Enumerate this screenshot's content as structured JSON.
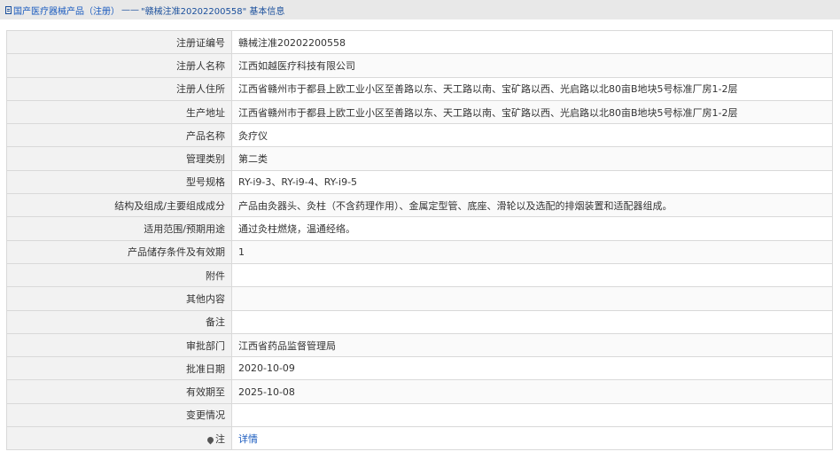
{
  "breadcrumb": {
    "root": "国产医疗器械产品（注册）",
    "separator": "——",
    "current": "\"赣械注准20202200558\" 基本信息"
  },
  "rows": [
    {
      "label": "注册证编号",
      "value": "赣械注准20202200558"
    },
    {
      "label": "注册人名称",
      "value": "江西如越医疗科技有限公司"
    },
    {
      "label": "注册人住所",
      "value": "江西省赣州市于都县上欧工业小区至善路以东、天工路以南、宝矿路以西、光启路以北80亩B地块5号标准厂房1-2层"
    },
    {
      "label": "生产地址",
      "value": "江西省赣州市于都县上欧工业小区至善路以东、天工路以南、宝矿路以西、光启路以北80亩B地块5号标准厂房1-2层"
    },
    {
      "label": "产品名称",
      "value": "灸疗仪"
    },
    {
      "label": "管理类别",
      "value": "第二类"
    },
    {
      "label": "型号规格",
      "value": "RY-i9-3、RY-i9-4、RY-i9-5"
    },
    {
      "label": "结构及组成/主要组成成分",
      "value": "产品由灸器头、灸柱（不含药理作用）、金属定型管、底座、滑轮以及选配的排烟装置和适配器组成。"
    },
    {
      "label": "适用范围/预期用途",
      "value": "通过灸柱燃烧，温通经络。"
    },
    {
      "label": "产品储存条件及有效期",
      "value": "1"
    },
    {
      "label": "附件",
      "value": ""
    },
    {
      "label": "其他内容",
      "value": ""
    },
    {
      "label": "备注",
      "value": ""
    },
    {
      "label": "审批部门",
      "value": "江西省药品监督管理局"
    },
    {
      "label": "批准日期",
      "value": "2020-10-09"
    },
    {
      "label": "有效期至",
      "value": "2025-10-08"
    },
    {
      "label": "变更情况",
      "value": ""
    }
  ],
  "note": {
    "label": "注",
    "link_text": "详情"
  }
}
